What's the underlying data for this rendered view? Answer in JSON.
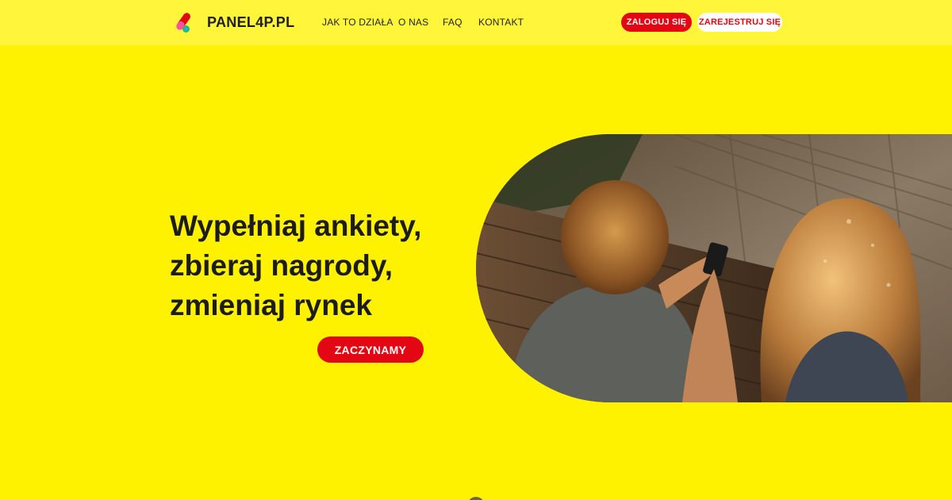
{
  "header": {
    "brand": "PANEL4P.PL",
    "nav": [
      "JAK TO DZIAŁA",
      "O NAS",
      "FAQ",
      "KONTAKT"
    ],
    "login_label": "ZALOGUJ SIĘ",
    "register_label": "ZAREJESTRUJ SIĘ"
  },
  "hero": {
    "headline": [
      "Wypełniaj ankiety,",
      "zbieraj nagrody,",
      "zmieniaj rynek"
    ],
    "cta_label": "ZACZYNAMY"
  },
  "colors": {
    "background": "#fff200",
    "header_background": "#fff53a",
    "accent_red": "#e30613",
    "text_dark": "#1c1c1c"
  }
}
